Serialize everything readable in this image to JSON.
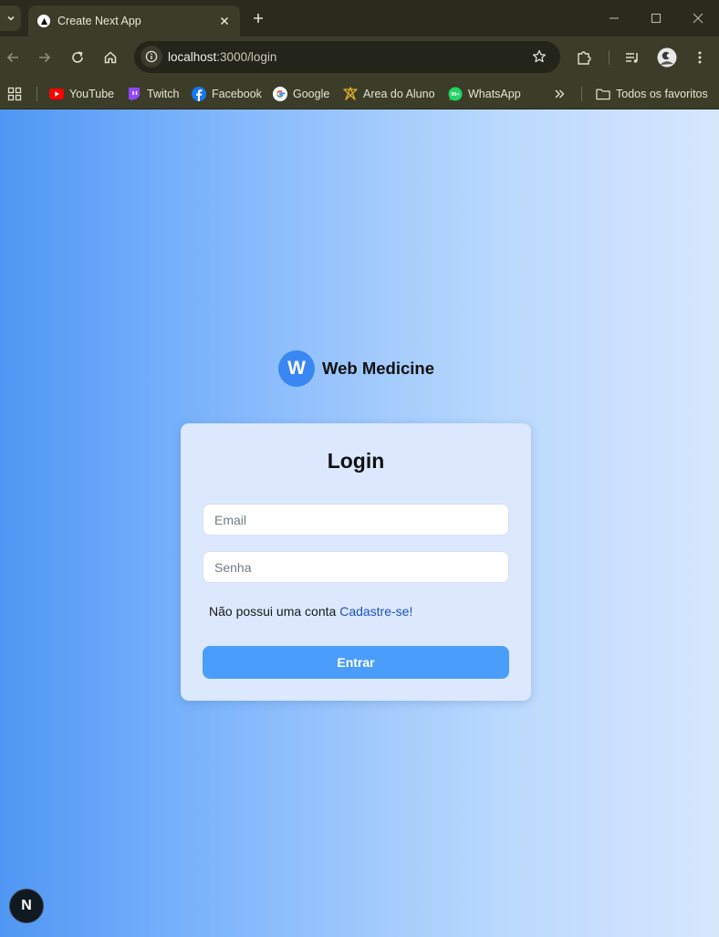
{
  "browser": {
    "tab": {
      "title": "Create Next App"
    },
    "address_bar": {
      "host": "localhost",
      "path": ":3000/login"
    },
    "bookmarks": [
      {
        "label": "YouTube",
        "icon": "youtube-icon"
      },
      {
        "label": "Twitch",
        "icon": "twitch-icon"
      },
      {
        "label": "Facebook",
        "icon": "facebook-icon"
      },
      {
        "label": "Google",
        "icon": "google-icon"
      },
      {
        "label": "Area do Aluno",
        "icon": "area-do-aluno-icon"
      },
      {
        "label": "WhatsApp",
        "icon": "whatsapp-icon"
      }
    ],
    "all_bookmarks_label": "Todos os favoritos"
  },
  "brand": {
    "initial": "W",
    "name": "Web Medicine",
    "color": "#3a86f2"
  },
  "login": {
    "title": "Login",
    "email_placeholder": "Email",
    "password_placeholder": "Senha",
    "signup_prompt": "Não possui uma conta",
    "signup_link": "Cadastre-se!",
    "submit_label": "Entrar",
    "button_color": "#4a9efa"
  },
  "dev_badge": {
    "label": "N"
  }
}
